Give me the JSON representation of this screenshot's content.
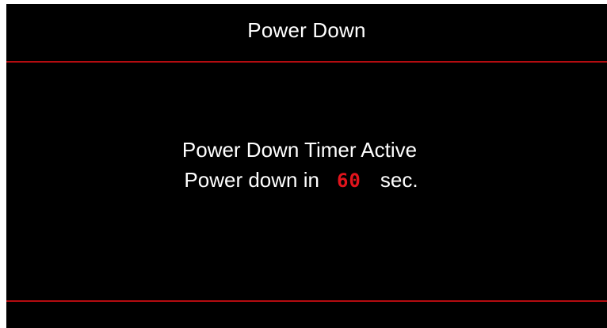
{
  "dialog": {
    "title": "Power Down",
    "message_line1": "Power Down Timer Active",
    "message_prefix": "Power down in",
    "countdown_value": "60",
    "countdown_unit": "sec."
  },
  "colors": {
    "background": "#000000",
    "divider": "#b40c10",
    "text": "#ffffff",
    "countdown": "#e1141c"
  }
}
